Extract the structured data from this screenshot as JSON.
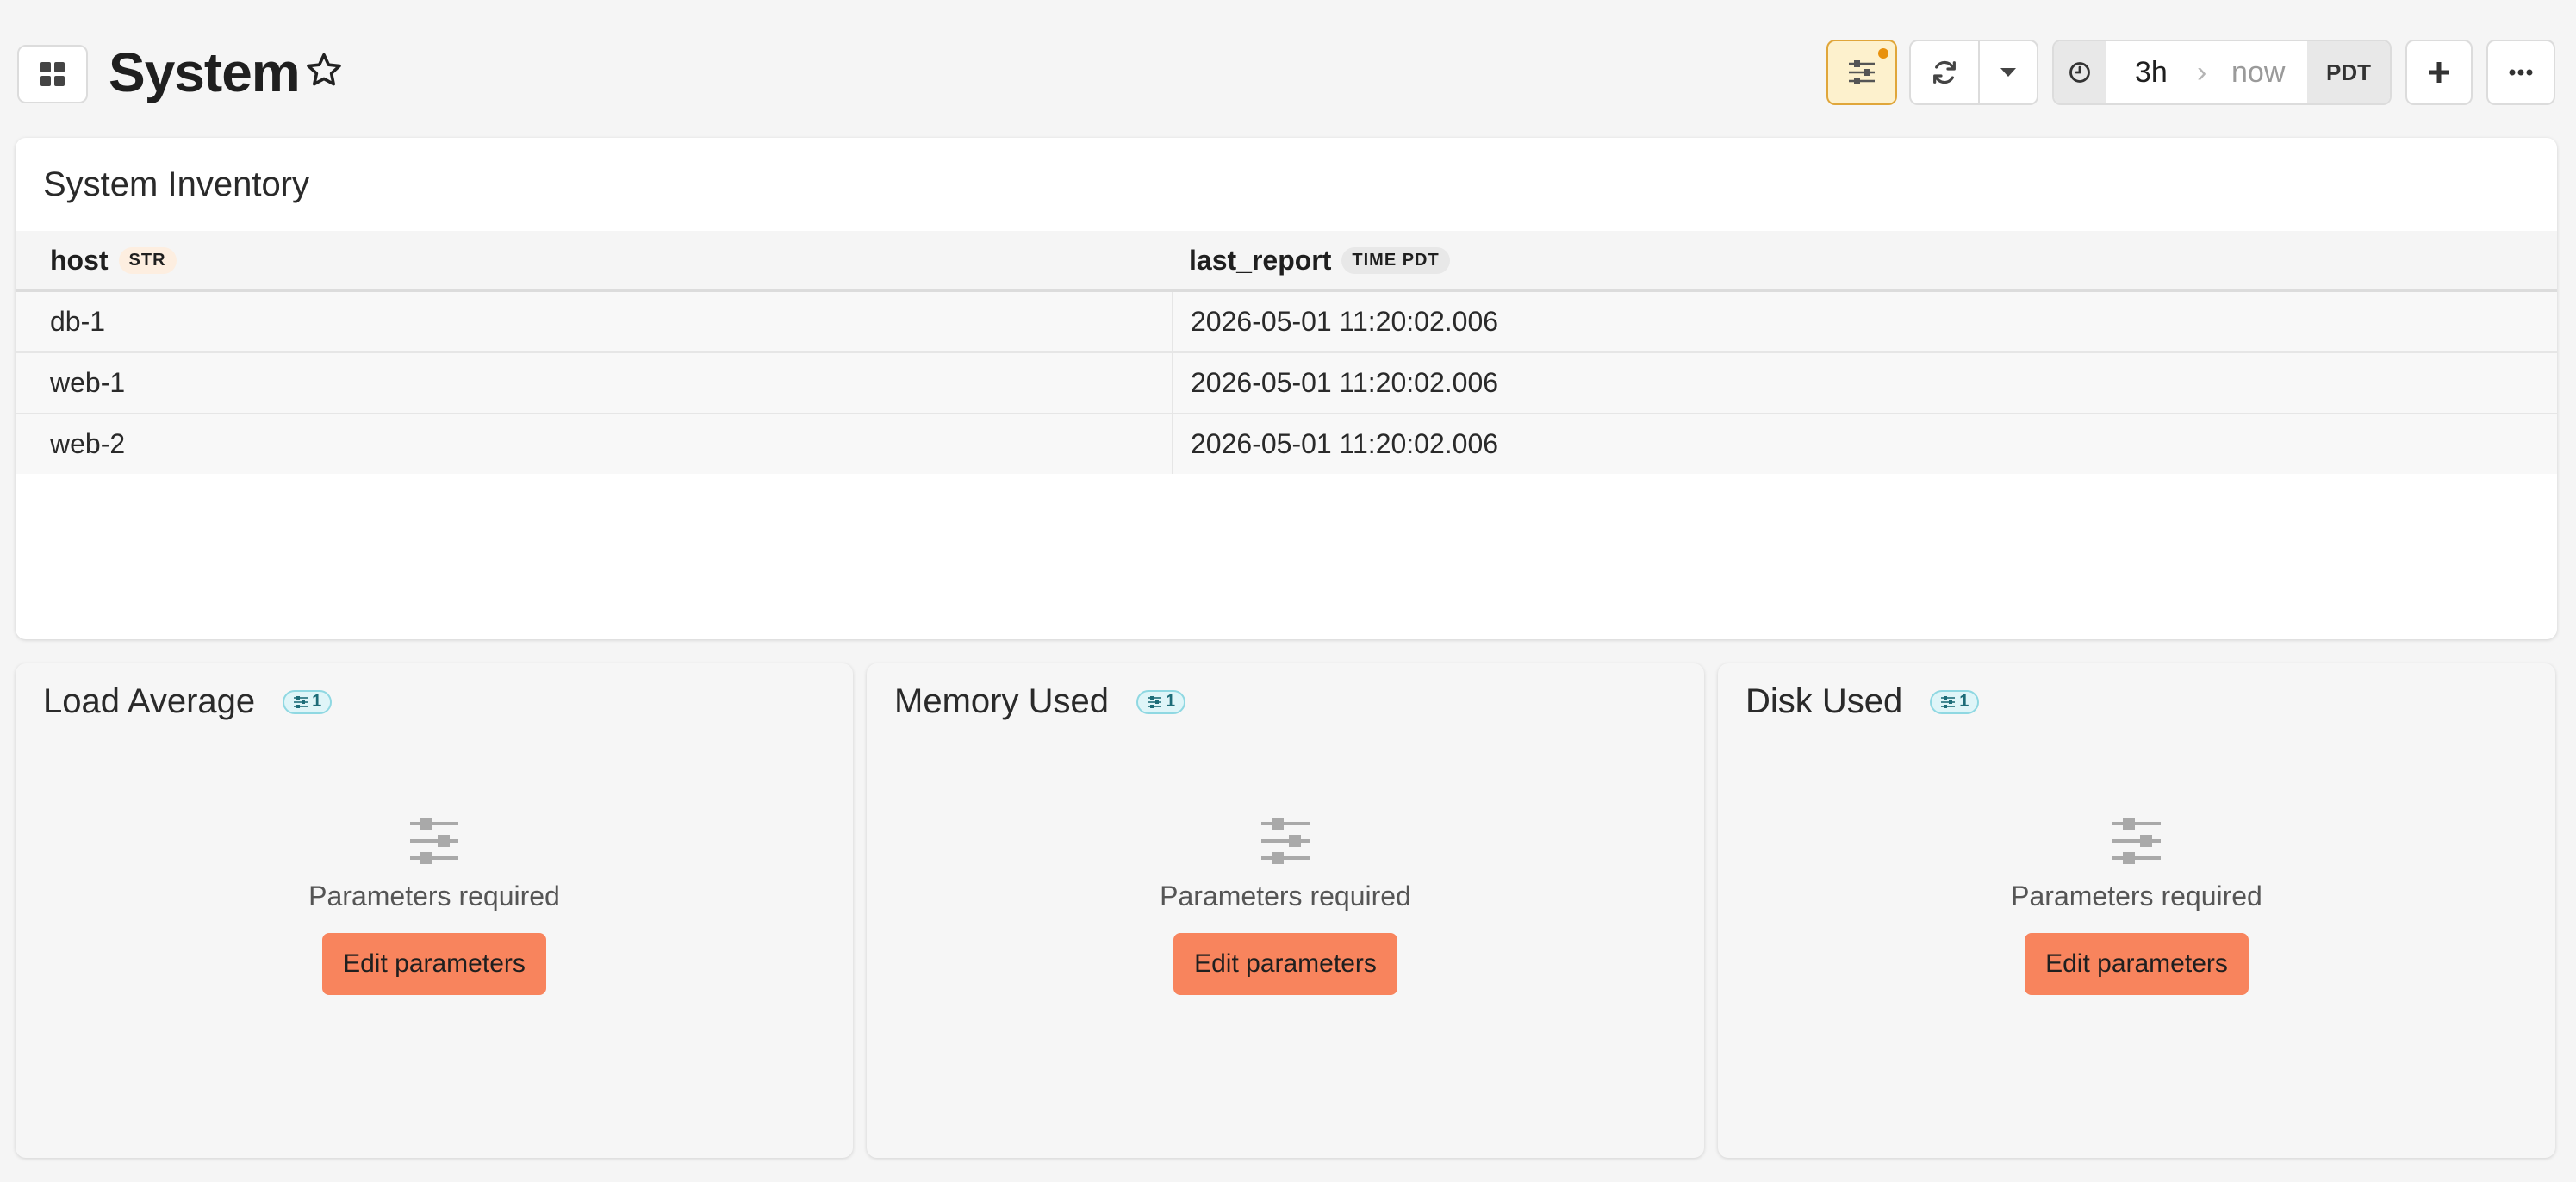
{
  "header": {
    "title": "System",
    "time_range": {
      "start": "3h",
      "arrow": "›",
      "end": "now",
      "timezone": "PDT"
    },
    "params_indicator_color": "#e8910d",
    "icons": {
      "dashboard": "grid-icon",
      "favorite": "star-icon",
      "parameters": "sliders-icon",
      "refresh": "refresh-icon",
      "refresh_menu": "caret-down-icon",
      "time": "clock-icon",
      "add": "plus-icon",
      "more": "ellipsis-icon"
    }
  },
  "inventory": {
    "title": "System Inventory",
    "columns": [
      {
        "name": "host",
        "type": "STR"
      },
      {
        "name": "last_report",
        "type": "TIME PDT"
      }
    ],
    "rows": [
      {
        "host": "db-1",
        "last_report": "2026-05-01 11:20:02.006"
      },
      {
        "host": "web-1",
        "last_report": "2026-05-01 11:20:02.006"
      },
      {
        "host": "web-2",
        "last_report": "2026-05-01 11:20:02.006"
      }
    ]
  },
  "panels": [
    {
      "title": "Load Average",
      "param_count": "1",
      "message": "Parameters required",
      "action": "Edit parameters"
    },
    {
      "title": "Memory Used",
      "param_count": "1",
      "message": "Parameters required",
      "action": "Edit parameters"
    },
    {
      "title": "Disk Used",
      "param_count": "1",
      "message": "Parameters required",
      "action": "Edit parameters"
    }
  ],
  "colors": {
    "accent_button": "#f8845d",
    "param_chip": "#dff5f8",
    "params_active": "#fdf1cd"
  }
}
